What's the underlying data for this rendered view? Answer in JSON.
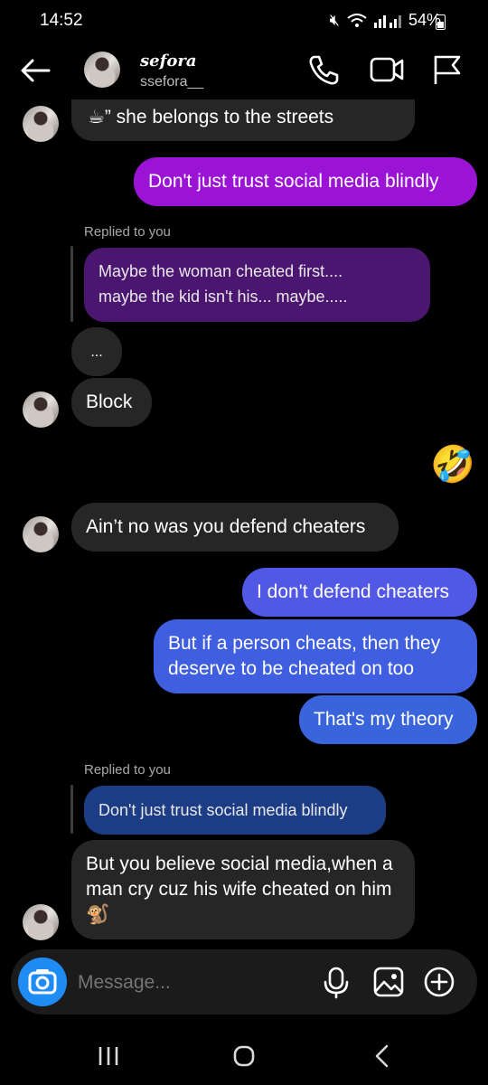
{
  "status": {
    "time": "14:52",
    "battery": "54%"
  },
  "header": {
    "display_name": "sefora",
    "username": "ssefora__"
  },
  "messages": {
    "m1": "☕” she belongs to the streets",
    "m2": "Don't just trust social media blindly",
    "reply1_label": "Replied to you",
    "reply1_quote": "Maybe the woman cheated first....\nmaybe the kid isn't his... maybe.....",
    "m3": "...",
    "m4": "Block",
    "m5": "🤣",
    "m6": "Ain’t no was you defend cheaters",
    "m7": "I don't defend cheaters",
    "m8": "But if a person cheats, then they deserve to be cheated on too",
    "m9": "That's my theory",
    "reply2_label": "Replied to you",
    "reply2_quote": "Don't just trust social media blindly",
    "m10": "But you believe social media,when a man cry cuz his wife cheated on him🐒"
  },
  "composer": {
    "placeholder": "Message..."
  },
  "colors": {
    "accent_purple": "#9b14d6",
    "accent_blue": "#3f5ee0",
    "camera": "#1e8cf3"
  },
  "icons": [
    "back-arrow-icon",
    "phone-icon",
    "video-icon",
    "flag-icon",
    "camera-icon",
    "microphone-icon",
    "gallery-icon",
    "plus-circle-icon",
    "recents-icon",
    "home-icon",
    "back-nav-icon"
  ]
}
